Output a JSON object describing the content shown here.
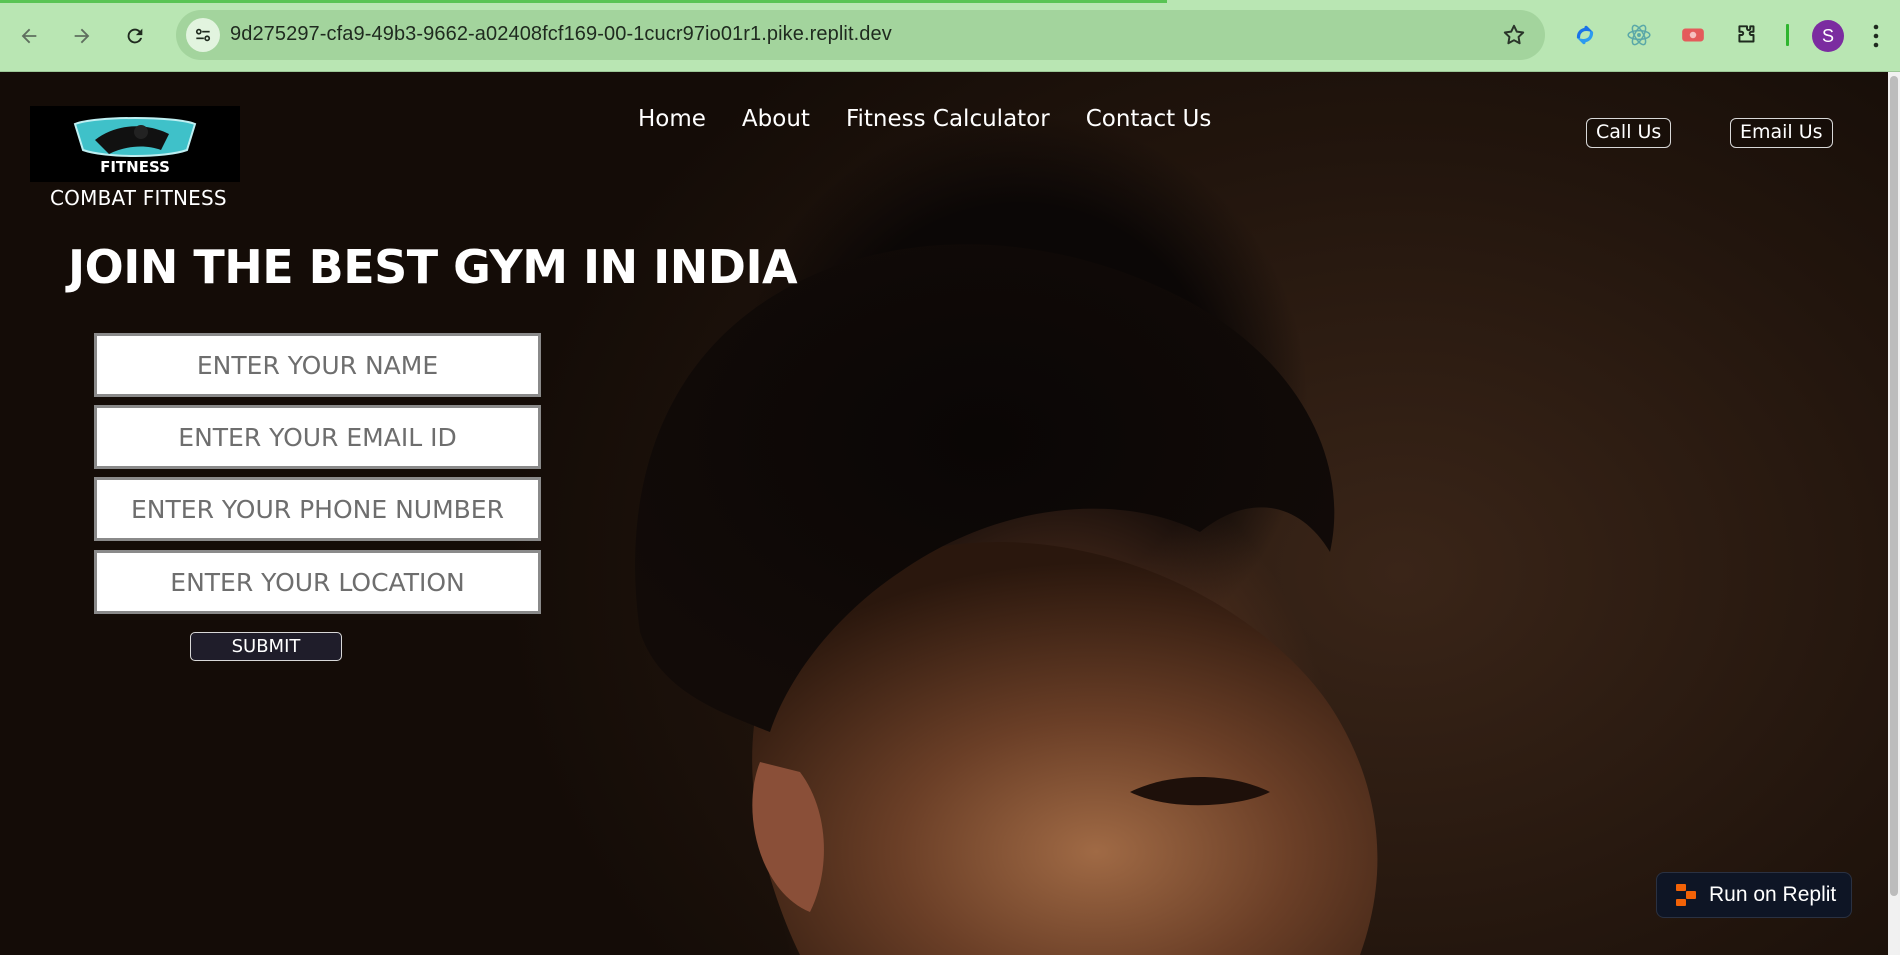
{
  "browser": {
    "url": "9d275297-cfa9-49b3-9662-a02408fcf169-00-1cucr97io01r1.pike.replit.dev",
    "profile_initial": "S",
    "icons": [
      "back-arrow-icon",
      "forward-arrow-icon",
      "reload-icon",
      "site-info-icon",
      "bookmark-star-icon",
      "extension-sync-icon",
      "extension-react-icon",
      "extension-video-icon",
      "extensions-puzzle-icon",
      "more-menu-icon"
    ]
  },
  "site": {
    "brand_name": "COMBAT FITNESS",
    "logo_text": "FITNESS",
    "nav": [
      "Home",
      "About",
      "Fitness Calculator",
      "Contact Us"
    ],
    "call_label": "Call Us",
    "email_label": "Email Us",
    "headline": "JOIN THE BEST GYM IN INDIA",
    "form": {
      "name_placeholder": "ENTER YOUR NAME",
      "email_placeholder": "ENTER YOUR EMAIL ID",
      "phone_placeholder": "ENTER YOUR PHONE NUMBER",
      "location_placeholder": "ENTER YOUR LOCATION",
      "submit_label": "SUBMIT"
    }
  },
  "replit_badge": {
    "label": "Run on Replit"
  },
  "colors": {
    "chrome_bg": "#b9e6b3",
    "omnibox_bg": "#a3d49d",
    "page_bg": "#1a0e08",
    "badge_bg": "#0e1525",
    "accent_orange": "#f26207"
  }
}
